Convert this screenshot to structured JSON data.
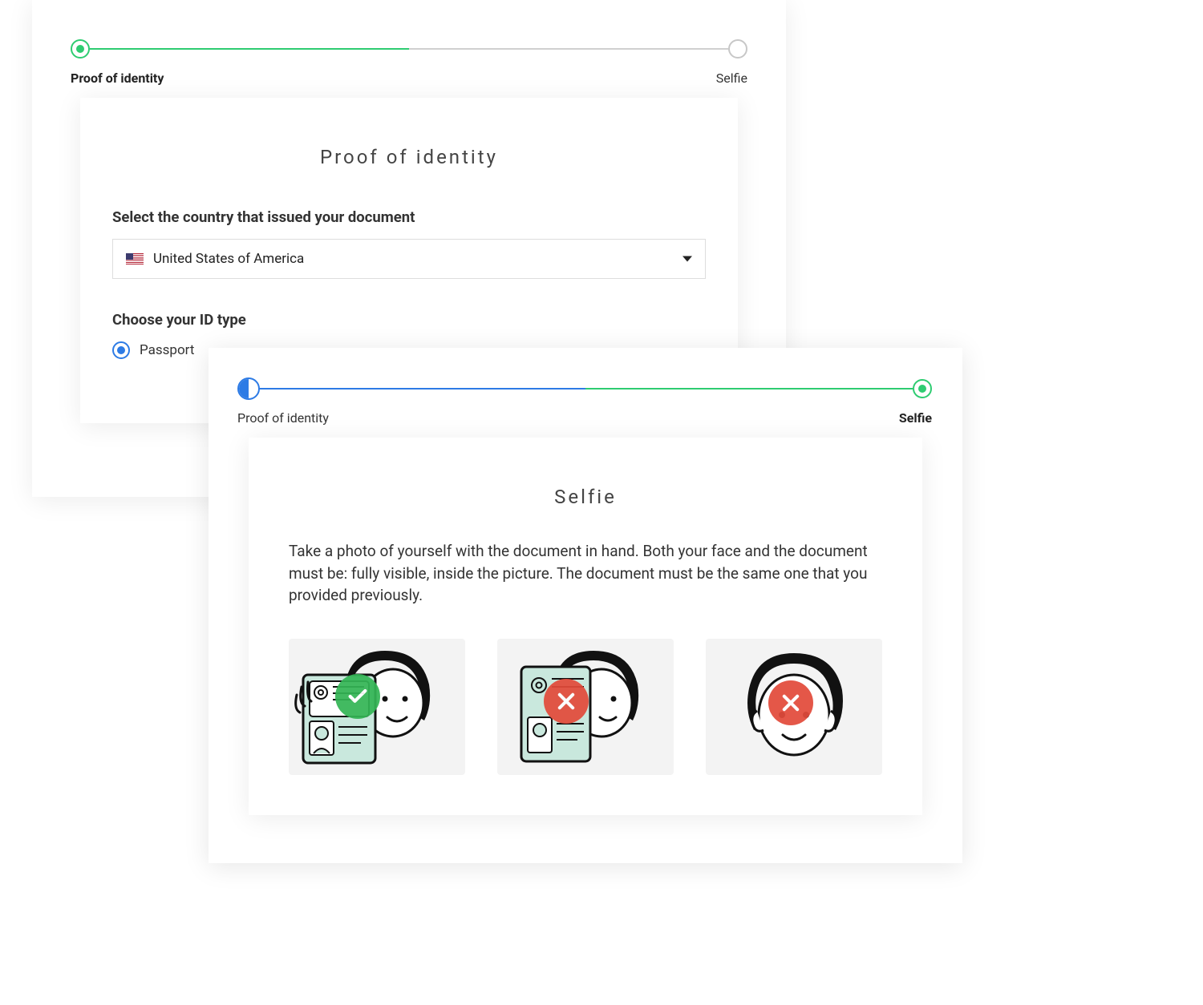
{
  "card1": {
    "progress": {
      "step1_label": "Proof of identity",
      "step2_label": "Selfie",
      "active_step": 1
    },
    "panel": {
      "title": "Proof of identity",
      "country_label": "Select the country that issued your document",
      "country_selected": "United States of America",
      "id_type_label": "Choose your ID type",
      "id_type_options": [
        {
          "label": "Passport",
          "selected": true
        }
      ]
    }
  },
  "card2": {
    "progress": {
      "step1_label": "Proof of identity",
      "step2_label": "Selfie",
      "active_step": 2
    },
    "panel": {
      "title": "Selfie",
      "instructions": "Take a photo of yourself with the document in hand. Both your face and the document must be: fully visible, inside the picture. The document must be the same one that you provided previously.",
      "examples": [
        {
          "status": "correct",
          "icon": "check-icon",
          "badge_color": "#34b555"
        },
        {
          "status": "incorrect",
          "icon": "cross-icon",
          "badge_color": "#e24b3b"
        },
        {
          "status": "incorrect",
          "icon": "cross-icon",
          "badge_color": "#e24b3b"
        }
      ]
    }
  },
  "colors": {
    "green": "#2ecc71",
    "blue": "#2d7be5",
    "badge_green": "#34b555",
    "badge_red": "#e24b3b",
    "grey": "#d0d0d0"
  }
}
